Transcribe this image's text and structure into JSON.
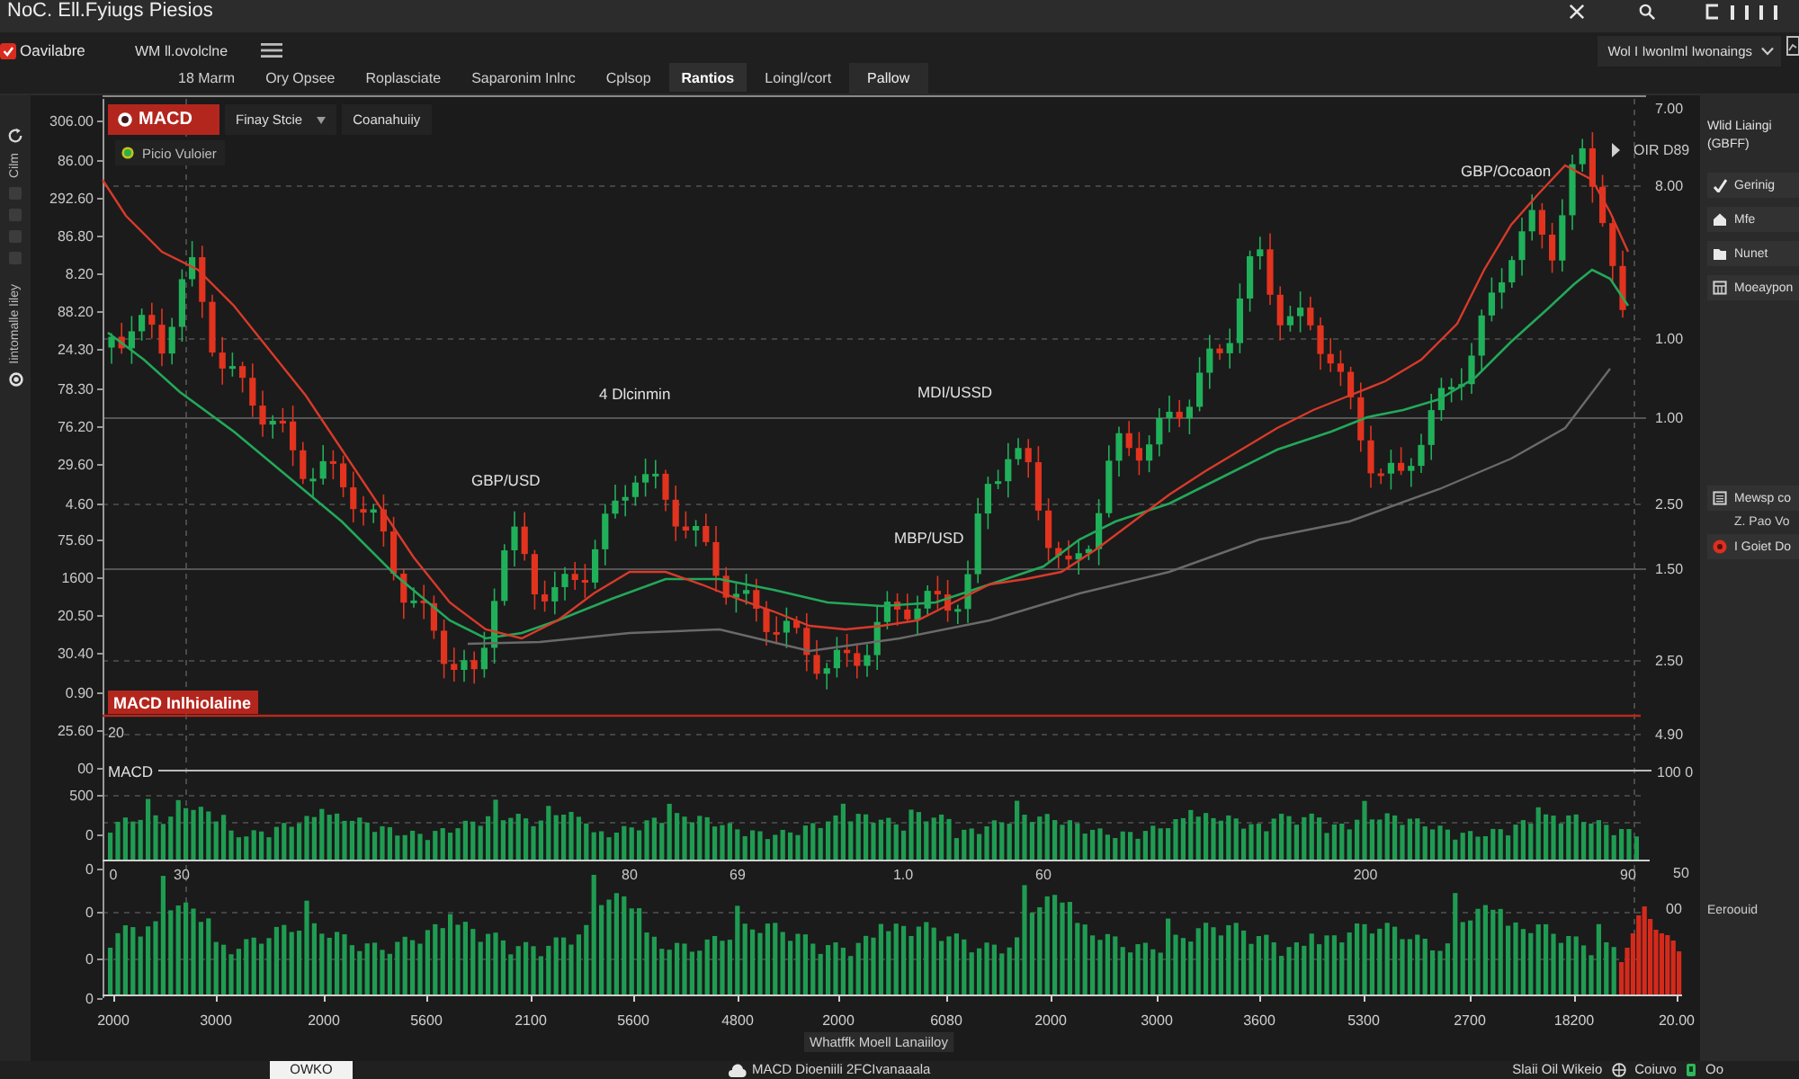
{
  "window": {
    "title": "NoC. Ell.Fyiugs Piesios"
  },
  "toolbar": {
    "brand": "Oavilabre",
    "workspace": "WM ll.ovolclne",
    "view_dropdown": "Wol I Iwonlml Iwonaings",
    "action_button": "Pallow"
  },
  "tabs": [
    {
      "label": "18 Marm",
      "selected": false
    },
    {
      "label": "Ory Opsee",
      "selected": false
    },
    {
      "label": "Roplasciate",
      "selected": false
    },
    {
      "label": "Saparonim Inlnc",
      "selected": false
    },
    {
      "label": "Cplsop",
      "selected": false
    },
    {
      "label": "Rantios",
      "selected": true
    },
    {
      "label": "Loingl/cort",
      "selected": false
    }
  ],
  "sidebar": {
    "labels": [
      "Cilm",
      "Iintomalle Iiley"
    ]
  },
  "chart": {
    "indicator": "MACD",
    "style_dropdown": "Finay Stcie",
    "compare_button": "Coanahuiiy",
    "legend": "Picio Vuloier",
    "left_axis": [
      "306.00",
      "86.00",
      "292.60",
      "86.80",
      "8.20",
      "88.20",
      "24.30",
      "78.30",
      "76.20",
      "29.60",
      "4.60",
      "75.60",
      "1600",
      "20.50",
      "30.40",
      "0.90",
      "25.60",
      "00",
      "500",
      "0",
      "0",
      "0",
      "0",
      "0"
    ],
    "right_axis": [
      "7.00",
      "8.00",
      "1.00",
      "1.00",
      "2.50",
      "1.50",
      "2.50",
      "4.90",
      "100 0",
      "50",
      "00"
    ],
    "price_tag": "OIR D89",
    "annotations": [
      "GBP/Ocoaon",
      "4 Dlcinmin",
      "MDI/USSD",
      "GBP/USD",
      "MBP/USD"
    ],
    "macd_label": "MACD Inlhiolaline",
    "macd_value": "20",
    "macd_line_label": "MACD",
    "histogram_axis": [
      "0",
      "30",
      "80",
      "69",
      "1.0",
      "60",
      "200",
      "90"
    ],
    "time_axis": [
      "2000",
      "3000",
      "2000",
      "5600",
      "2100",
      "5600",
      "4800",
      "2000",
      "6080",
      "2000",
      "3000",
      "3600",
      "5300",
      "2700",
      "18200",
      "20.00"
    ],
    "time_axis_title": "Whatffk Moell Lanaiiloy"
  },
  "right_panel": {
    "title": "Wlid Liaingi (GBFF)",
    "items": [
      {
        "label": "Gerinig",
        "kind": "check"
      },
      {
        "label": "Mfe",
        "kind": "house"
      },
      {
        "label": "Nunet",
        "kind": "folder"
      },
      {
        "label": "Moeaypon",
        "kind": "calendar"
      }
    ],
    "layers": [
      {
        "label": "Mewsp co",
        "detail": "Z. Pao Vo",
        "kind": "grid"
      },
      {
        "label": "I Goiet Do",
        "kind": "target"
      }
    ],
    "note": "Eeroouid"
  },
  "status_bar": {
    "button": "OWKO",
    "center": "MACD Dioeniili 2FCIvanaaala",
    "right": "Slaii Oil Wikeio",
    "region": "Coiuvo",
    "last": "Oo"
  }
}
